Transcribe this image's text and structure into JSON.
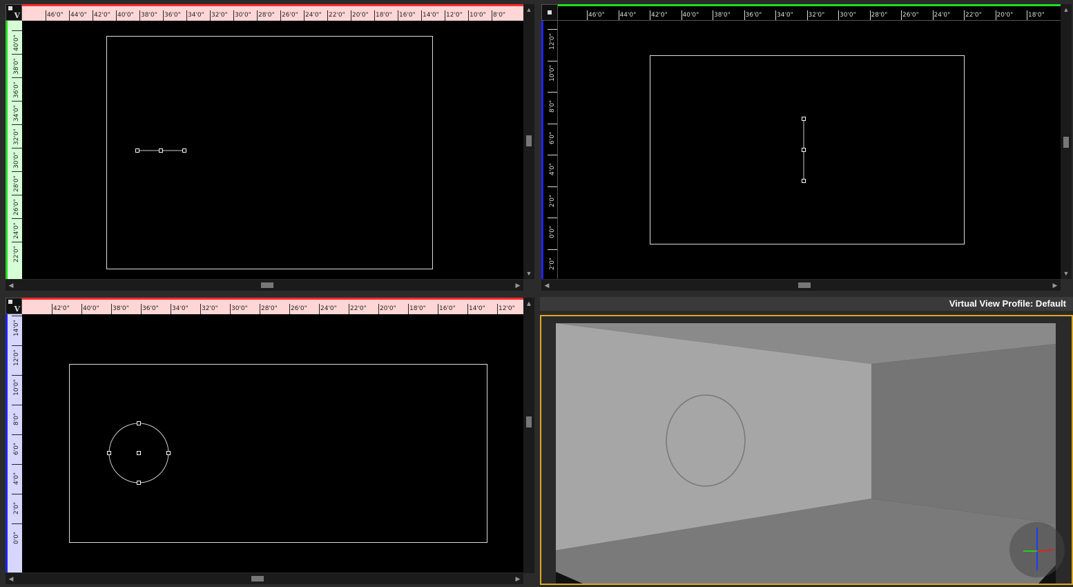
{
  "top_left": {
    "corner_letter": "V",
    "h_ruler_labels": [
      "46'0\"",
      "44'0\"",
      "42'0\"",
      "40'0\"",
      "38'0\"",
      "36'0\"",
      "34'0\"",
      "32'0\"",
      "30'0\"",
      "28'0\"",
      "26'0\"",
      "24'0\"",
      "22'0\"",
      "20'0\"",
      "18'0\"",
      "16'0\"",
      "14'0\"",
      "12'0\"",
      "10'0\"",
      "8'0\""
    ],
    "v_ruler_labels": [
      "40'0\"",
      "38'0\"",
      "36'0\"",
      "34'0\"",
      "32'0\"",
      "30'0\"",
      "28'0\"",
      "26'0\"",
      "24'0\"",
      "22'0\""
    ],
    "h_ruler_color": "#ffd6d6",
    "h_ruler_accent": "#ff2a2a",
    "v_ruler_color": "#d6ffd6",
    "v_ruler_accent": "#22dd22"
  },
  "top_right": {
    "h_ruler_labels": [
      "46'0\"",
      "44'0\"",
      "42'0\"",
      "40'0\"",
      "38'0\"",
      "36'0\"",
      "34'0\"",
      "32'0\"",
      "30'0\"",
      "28'0\"",
      "26'0\"",
      "24'0\"",
      "22'0\"",
      "20'0\"",
      "18'0\""
    ],
    "v_ruler_labels": [
      "12'0\"",
      "10'0\"",
      "8'0\"",
      "6'0\"",
      "4'0\"",
      "2'0\"",
      "0'0\"",
      "2'0\""
    ],
    "h_ruler_color": "#000000",
    "h_ruler_accent": "#22dd22",
    "v_ruler_color": "#000000",
    "v_ruler_accent": "#2222ff"
  },
  "bottom_left": {
    "corner_letter": "V",
    "h_ruler_labels": [
      "42'0\"",
      "40'0\"",
      "38'0\"",
      "36'0\"",
      "34'0\"",
      "32'0\"",
      "30'0\"",
      "28'0\"",
      "26'0\"",
      "24'0\"",
      "22'0\"",
      "20'0\"",
      "18'0\"",
      "16'0\"",
      "14'0\"",
      "12'0\""
    ],
    "v_ruler_labels": [
      "14'0\"",
      "12'0\"",
      "10'0\"",
      "8'0\"",
      "6'0\"",
      "4'0\"",
      "2'0\"",
      "0'0\""
    ],
    "h_ruler_color": "#ffd6d6",
    "h_ruler_accent": "#ff2a2a",
    "v_ruler_color": "#d6d6ff",
    "v_ruler_accent": "#2222ff"
  },
  "virtual_view": {
    "title": "Virtual View Profile: Default",
    "frame_color": "#e0a820"
  }
}
